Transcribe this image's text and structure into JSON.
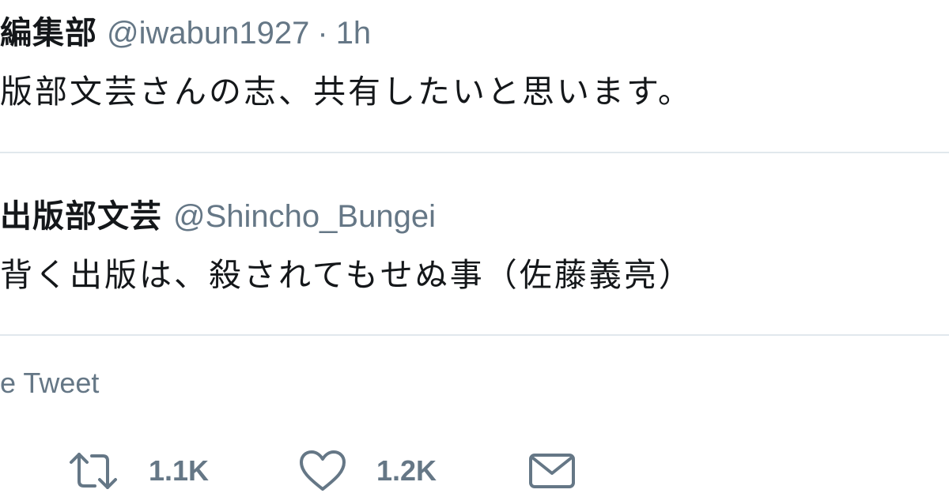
{
  "tweet": {
    "author_name": "編集部",
    "author_handle": "@iwabun1927",
    "separator": "·",
    "timestamp": "1h",
    "text": "版部文芸さんの志、共有したいと思います。"
  },
  "quoted_tweet": {
    "author_name": "出版部文芸",
    "author_handle": "@Shincho_Bungei",
    "text": "背く出版は、殺されてもせぬ事（佐藤義亮）"
  },
  "quote_tweet_link": "e Tweet",
  "actions": {
    "retweet_count": "1.1K",
    "like_count": "1.2K"
  },
  "icons": {
    "retweet": "retweet-icon",
    "like": "heart-icon",
    "dm": "envelope-icon"
  },
  "colors": {
    "text": "#14171a",
    "secondary": "#657786",
    "divider": "#e1e8ed"
  }
}
